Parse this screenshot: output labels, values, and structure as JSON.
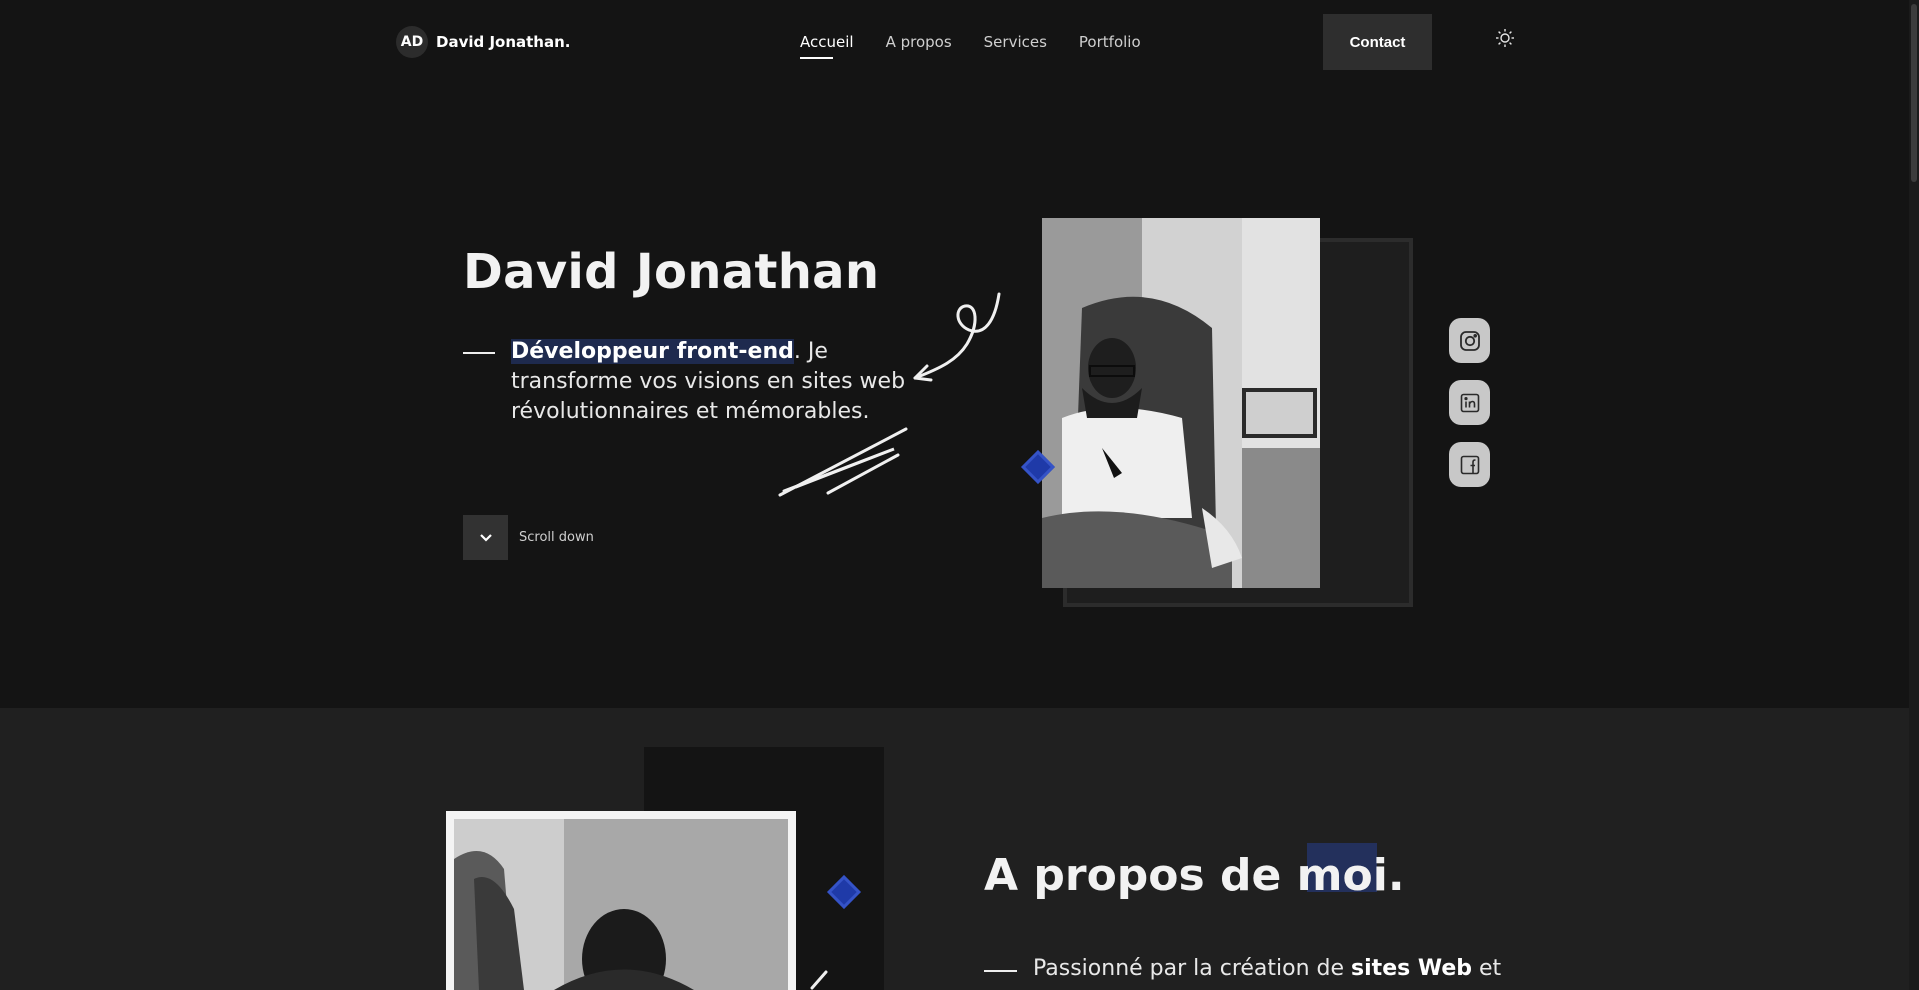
{
  "header": {
    "logo_initials": "AD",
    "logo_name": "David Jonathan.",
    "nav": [
      {
        "label": "Accueil",
        "active": true
      },
      {
        "label": "A propos",
        "active": false
      },
      {
        "label": "Services",
        "active": false
      },
      {
        "label": "Portfolio",
        "active": false
      }
    ],
    "contact_label": "Contact",
    "theme_icon": "sun-icon"
  },
  "hero": {
    "title": "David Jonathan",
    "role_highlight": "Développeur front-end",
    "tagline_rest": ". Je transforme vos visions en sites web révolutionnaires et mémorables.",
    "scroll_label": "Scroll down",
    "scroll_icon": "chevron-down-icon"
  },
  "socials": [
    {
      "name": "instagram-icon"
    },
    {
      "name": "linkedin-icon"
    },
    {
      "name": "facebook-icon"
    }
  ],
  "about": {
    "title": "A propos de moi.",
    "text_prefix": "Passionné par la création de ",
    "text_bold": "sites Web",
    "text_suffix": " et"
  },
  "colors": {
    "background": "#141414",
    "section_alt": "#202020",
    "accent_blue": "#1f3aa8",
    "highlight": "#1e2a4e"
  }
}
